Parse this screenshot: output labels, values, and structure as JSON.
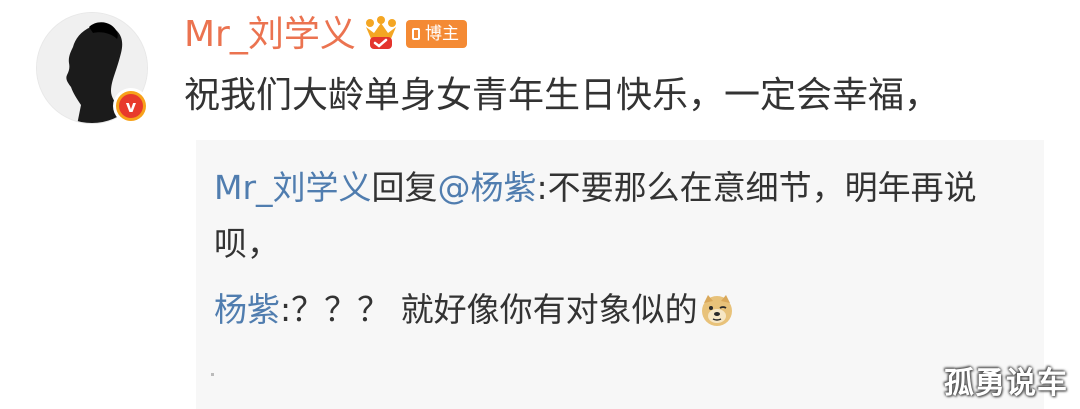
{
  "comment": {
    "username": "Mr_刘学义",
    "role_badge": "博主",
    "text": "祝我们大龄单身女青年生日快乐，一定会幸福，"
  },
  "replies": [
    {
      "author": "Mr_刘学义",
      "connector": "回复",
      "mention": "@杨紫",
      "separator": ":",
      "text": "不要那么在意细节，明年再说呗，"
    },
    {
      "author": "杨紫",
      "separator": ":",
      "text": "？？？ 就好像你有对象似的",
      "emoji": "doge-icon"
    }
  ],
  "watermark": "孤勇说车",
  "colors": {
    "username": "#eb7350",
    "link": "#507daf",
    "text": "#333333",
    "reply_bg": "#f7f7f7",
    "badge_bg": "#f48a34",
    "verified_outer": "#f7a21b",
    "verified_inner": "#e83a2c"
  },
  "icons": {
    "avatar_verified": "verified-v-icon",
    "crown": "crown-icon",
    "emoji": "doge-icon"
  }
}
